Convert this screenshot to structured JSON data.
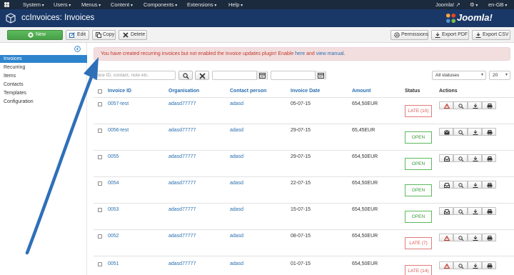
{
  "topnav": {
    "menus": [
      "System",
      "Users",
      "Menus",
      "Content",
      "Components",
      "Extensions",
      "Help"
    ],
    "site_name": "Joomla!",
    "language": "en-GB"
  },
  "header": {
    "title": "ccInvoices: Invoices",
    "brand": "Joomla!"
  },
  "toolbar": {
    "new_label": "New",
    "edit_label": "Edit",
    "copy_label": "Copy",
    "delete_label": "Delete",
    "permissions_label": "Permissions",
    "export_pdf_label": "Export PDF",
    "export_csv_label": "Export CSV"
  },
  "sidebar": {
    "items": [
      {
        "label": "Invoices"
      },
      {
        "label": "Recurring"
      },
      {
        "label": "Items"
      },
      {
        "label": "Contacts"
      },
      {
        "label": "Templates"
      },
      {
        "label": "Configuration"
      }
    ]
  },
  "alert": {
    "text_before": "You have created recurring invoices but not enabled the Invoice updates plugin! Enable ",
    "link1": "here",
    "text_mid": " and ",
    "link2": "view manual",
    "text_after": "."
  },
  "filters": {
    "search_placeholder": "oice ID, contact, note etc.",
    "status_value": "All statuses",
    "limit_value": "20"
  },
  "table": {
    "headers": {
      "invoice_id": "Invoice ID",
      "organisation": "Organisation",
      "contact": "Contact person",
      "date": "Invoice Date",
      "amount": "Amount",
      "status": "Status",
      "actions": "Actions"
    },
    "rows": [
      {
        "id": "0057-test",
        "org": "adasd77777",
        "contact": "adasd",
        "date": "05-07-15",
        "amount": "654,50EUR",
        "status": "LATE (10)"
      },
      {
        "id": "0056-test",
        "org": "adasd77777",
        "contact": "adasd",
        "date": "29-07-15",
        "amount": "65,45EUR",
        "status": "OPEN"
      },
      {
        "id": "0055",
        "org": "adasd77777",
        "contact": "adasd",
        "date": "29-07-15",
        "amount": "654,50EUR",
        "status": "OPEN"
      },
      {
        "id": "0054",
        "org": "adasd77777",
        "contact": "adasd",
        "date": "22-07-15",
        "amount": "654,50EUR",
        "status": "OPEN"
      },
      {
        "id": "0053",
        "org": "adasd77777",
        "contact": "adasd",
        "date": "15-07-15",
        "amount": "654,50EUR",
        "status": "OPEN"
      },
      {
        "id": "0052",
        "org": "adasd77777",
        "contact": "adasd",
        "date": "08-07-15",
        "amount": "654,50EUR",
        "status": "LATE (7)"
      },
      {
        "id": "0051",
        "org": "adasd77777",
        "contact": "adasd",
        "date": "01-07-15",
        "amount": "654,50EUR",
        "status": "LATE (14)"
      }
    ]
  },
  "colors": {
    "topnav_bg": "#1b2a3d",
    "header_bg": "#1a3867",
    "accent": "#2d84cc",
    "new_button": "#51ac51",
    "alert_bg": "#f2dede",
    "late": "#d9534f",
    "open": "#5cb85c",
    "arrow": "#2f6fb8"
  }
}
